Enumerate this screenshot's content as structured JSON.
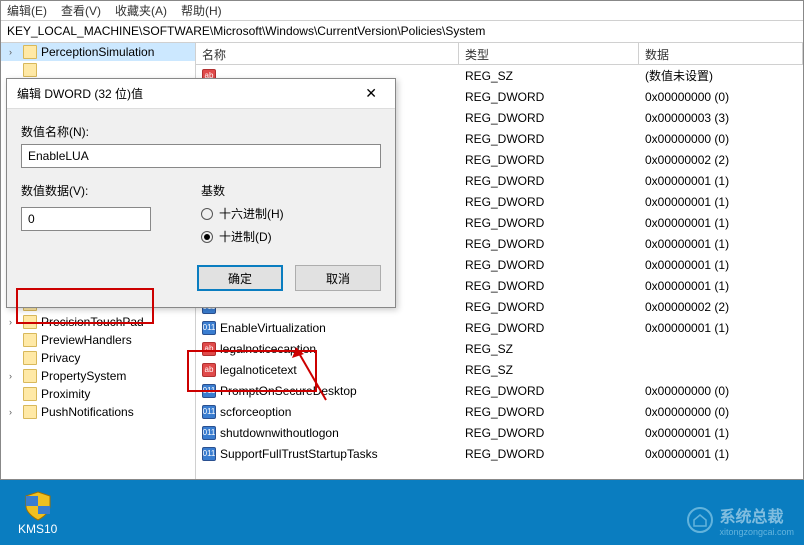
{
  "menu": {
    "edit": "编辑(E)",
    "view": "查看(V)",
    "fav": "收藏夹(A)",
    "help": "帮助(H)"
  },
  "address": "KEY_LOCAL_MACHINE\\SOFTWARE\\Microsoft\\Windows\\CurrentVersion\\Policies\\System",
  "tree": [
    {
      "label": "PerceptionSimulation",
      "chev": "›"
    },
    {
      "label": "",
      "chev": ""
    },
    {
      "label": "",
      "chev": ""
    },
    {
      "label": "",
      "chev": ""
    },
    {
      "label": "",
      "chev": ""
    },
    {
      "label": "",
      "chev": ""
    },
    {
      "label": "",
      "chev": ""
    },
    {
      "label": "",
      "chev": ""
    },
    {
      "label": "",
      "chev": ""
    },
    {
      "label": "",
      "chev": ""
    },
    {
      "label": "",
      "chev": ""
    },
    {
      "label": "",
      "chev": ""
    },
    {
      "label": "",
      "chev": ""
    },
    {
      "label": "",
      "chev": ""
    },
    {
      "label": "",
      "chev": ""
    },
    {
      "label": "PrecisionTouchPad",
      "chev": "›"
    },
    {
      "label": "PreviewHandlers",
      "chev": ""
    },
    {
      "label": "Privacy",
      "chev": ""
    },
    {
      "label": "PropertySystem",
      "chev": "›"
    },
    {
      "label": "Proximity",
      "chev": ""
    },
    {
      "label": "PushNotifications",
      "chev": "›"
    }
  ],
  "columns": {
    "name": "名称",
    "type": "类型",
    "data": "数据"
  },
  "rows": [
    {
      "icon": "sz",
      "name": "",
      "type": "REG_SZ",
      "data": "(数值未设置)"
    },
    {
      "icon": "dw",
      "name": "",
      "type": "REG_DWORD",
      "data": "0x00000000 (0)"
    },
    {
      "icon": "dw",
      "name": "",
      "type": "REG_DWORD",
      "data": "0x00000003 (3)"
    },
    {
      "icon": "dw",
      "name": "",
      "type": "REG_DWORD",
      "data": "0x00000000 (0)"
    },
    {
      "icon": "dw",
      "name": "",
      "type": "REG_DWORD",
      "data": "0x00000002 (2)"
    },
    {
      "icon": "dw",
      "name": "",
      "type": "REG_DWORD",
      "data": "0x00000001 (1)"
    },
    {
      "icon": "dw",
      "name": "",
      "type": "REG_DWORD",
      "data": "0x00000001 (1)"
    },
    {
      "icon": "dw",
      "name": "",
      "type": "REG_DWORD",
      "data": "0x00000001 (1)"
    },
    {
      "icon": "dw",
      "name": "",
      "type": "REG_DWORD",
      "data": "0x00000001 (1)"
    },
    {
      "icon": "dw",
      "name": "",
      "type": "REG_DWORD",
      "data": "0x00000001 (1)"
    },
    {
      "icon": "dw",
      "name": "",
      "type": "REG_DWORD",
      "data": "0x00000001 (1)"
    },
    {
      "icon": "dw",
      "name": "",
      "type": "REG_DWORD",
      "data": "0x00000002 (2)"
    },
    {
      "icon": "dw",
      "name": "EnableVirtualization",
      "type": "REG_DWORD",
      "data": "0x00000001 (1)"
    },
    {
      "icon": "sz",
      "name": "legalnoticecaption",
      "type": "REG_SZ",
      "data": ""
    },
    {
      "icon": "sz",
      "name": "legalnoticetext",
      "type": "REG_SZ",
      "data": ""
    },
    {
      "icon": "dw",
      "name": "PromptOnSecureDesktop",
      "type": "REG_DWORD",
      "data": "0x00000000 (0)"
    },
    {
      "icon": "dw",
      "name": "scforceoption",
      "type": "REG_DWORD",
      "data": "0x00000000 (0)"
    },
    {
      "icon": "dw",
      "name": "shutdownwithoutlogon",
      "type": "REG_DWORD",
      "data": "0x00000001 (1)"
    },
    {
      "icon": "dw",
      "name": "SupportFullTrustStartupTasks",
      "type": "REG_DWORD",
      "data": "0x00000001 (1)"
    }
  ],
  "dialog": {
    "title": "编辑 DWORD (32 位)值",
    "name_label": "数值名称(N):",
    "name_value": "EnableLUA",
    "data_label": "数值数据(V):",
    "data_value": "0",
    "base_label": "基数",
    "hex_label": "十六进制(H)",
    "dec_label": "十进制(D)",
    "ok": "确定",
    "cancel": "取消"
  },
  "desktop": {
    "kms": "KMS10"
  },
  "watermark": {
    "line1": "系统总裁",
    "line2": "xitongzongcai.com"
  },
  "icon_text": {
    "sz": "ab",
    "dw": "011"
  }
}
